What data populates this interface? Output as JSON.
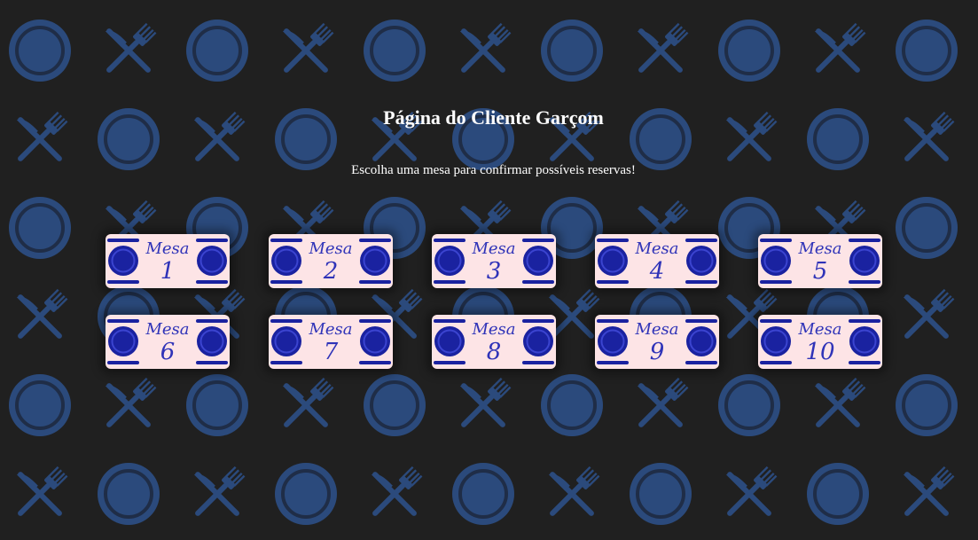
{
  "page": {
    "title": "Página do Cliente Garçom",
    "subtitle": "Escolha uma mesa para confirmar possíveis reservas!"
  },
  "background": {
    "pattern": [
      "plate-icon",
      "cutlery-icon"
    ],
    "base_color": "#202020",
    "icon_color": "#2b4a7c"
  },
  "tables": [
    {
      "label": "Mesa",
      "number": "1"
    },
    {
      "label": "Mesa",
      "number": "2"
    },
    {
      "label": "Mesa",
      "number": "3"
    },
    {
      "label": "Mesa",
      "number": "4"
    },
    {
      "label": "Mesa",
      "number": "5"
    },
    {
      "label": "Mesa",
      "number": "6"
    },
    {
      "label": "Mesa",
      "number": "7"
    },
    {
      "label": "Mesa",
      "number": "8"
    },
    {
      "label": "Mesa",
      "number": "9"
    },
    {
      "label": "Mesa",
      "number": "10"
    }
  ],
  "colors": {
    "card_bg": "#fde4e6",
    "accent_blue": "#2f33b8",
    "plate_blue": "#1a22a0",
    "text": "#ffffff"
  }
}
